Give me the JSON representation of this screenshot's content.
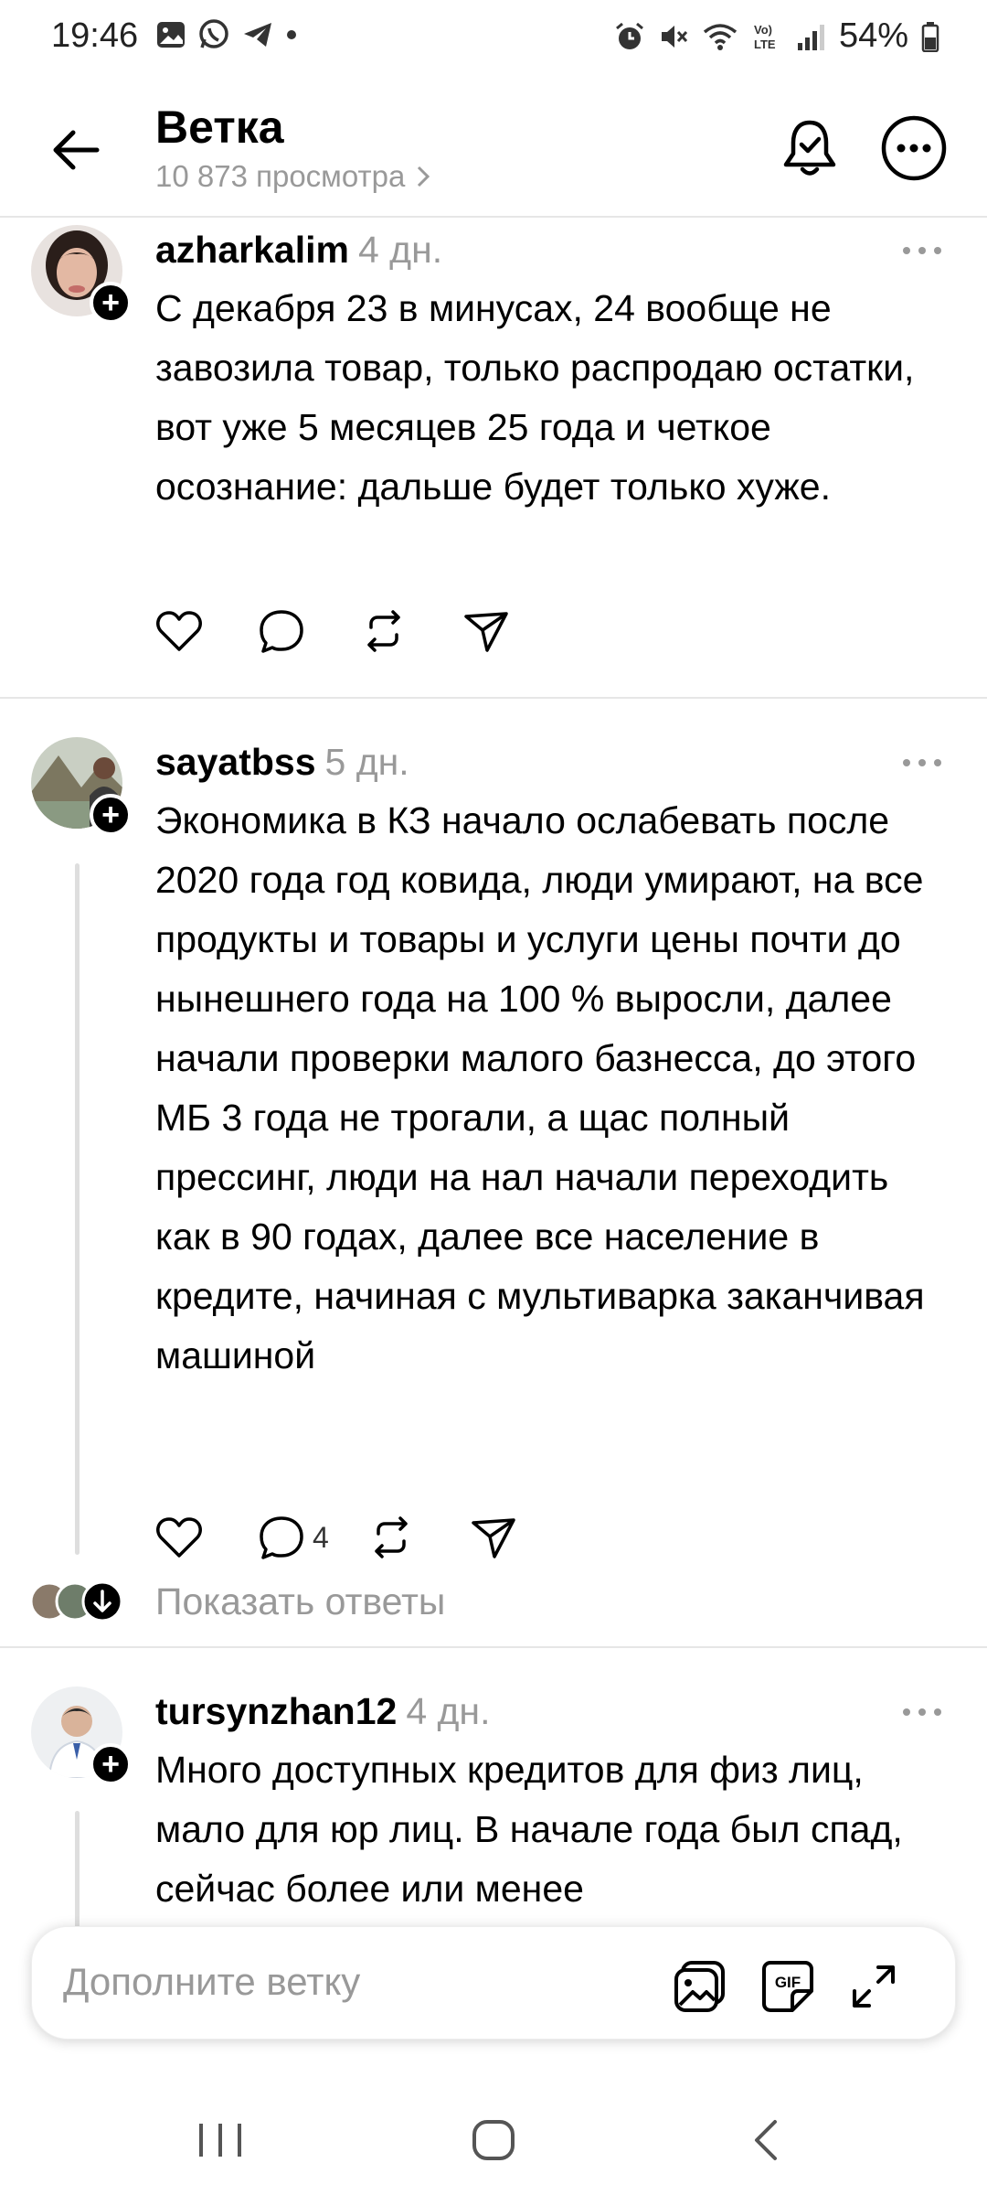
{
  "status_bar": {
    "time": "19:46",
    "battery": "54%",
    "left_icons": [
      "gallery-icon",
      "whatsapp-icon",
      "telegram-icon",
      "dot-icon"
    ],
    "right_icons": [
      "alarm-icon",
      "mute-icon",
      "wifi-icon",
      "volte-icon",
      "signal-icon",
      "battery-icon"
    ]
  },
  "header": {
    "title": "Ветка",
    "views": "10 873 просмотра"
  },
  "posts": [
    {
      "username": "azharkalim",
      "time": "4 дн.",
      "text": "С декабря 23 в минусах, 24 вообще не завозила товар, только распродаю остатки, вот уже 5 месяцев 25 года и четкое осознание: дальше будет только хуже.",
      "reply_count": ""
    },
    {
      "username": "sayatbss",
      "time": "5 дн.",
      "text": "Экономика в КЗ начало ослабевать после 2020 года год ковида, люди умирают, на все продукты и товары и услуги цены почти до нынешнего года на 100 % выросли, далее начали проверки малого базнесса, до этого МБ 3 года не трогали, а щас полный прессинг, люди на нал начали переходить как в 90 годах, далее все население в кредите, начиная с мультиварка заканчивая машиной",
      "reply_count": "4"
    },
    {
      "username": "tursynzhan12",
      "time": "4 дн.",
      "text": "Много доступных кредитов для физ лиц, мало для юр лиц. В начале года был спад, сейчас более или менее",
      "reply_count": ""
    }
  ],
  "show_replies": "Показать ответы",
  "composer": {
    "placeholder": "Дополните ветку",
    "gif_label": "GIF"
  }
}
